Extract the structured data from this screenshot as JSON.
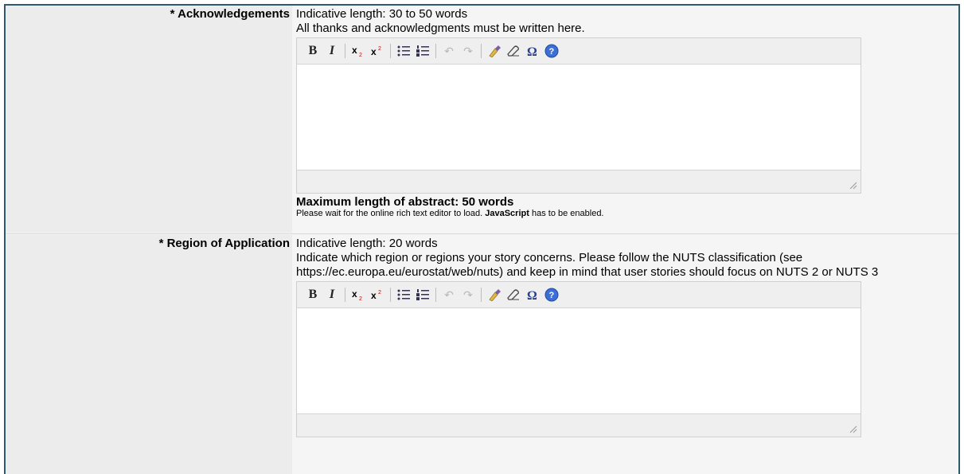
{
  "fields": [
    {
      "label": "* Acknowledgements",
      "indicative": "Indicative length: 30 to 50 words",
      "description": "All thanks and acknowledgments must be written here.",
      "max_length": "Maximum length of abstract: 50 words",
      "wait_prefix": "Please wait for the online rich text editor to load.",
      "wait_js": "JavaScript",
      "wait_suffix": "has to be enabled."
    },
    {
      "label": "* Region of Application",
      "indicative": "Indicative length: 20 words",
      "description": "Indicate which region or regions your story concerns. Please follow the NUTS classification (see https://ec.europa.eu/eurostat/web/nuts) and keep in mind that user stories should focus on NUTS 2 or NUTS 3"
    }
  ],
  "toolbar": {
    "bold": "B",
    "italic": "I",
    "subscript": "x₂",
    "superscript": "x²",
    "bullet_list": "☰",
    "numbered_list": "☷",
    "undo": "↶",
    "redo": "↷",
    "special_char": "Ω",
    "help": "?"
  }
}
